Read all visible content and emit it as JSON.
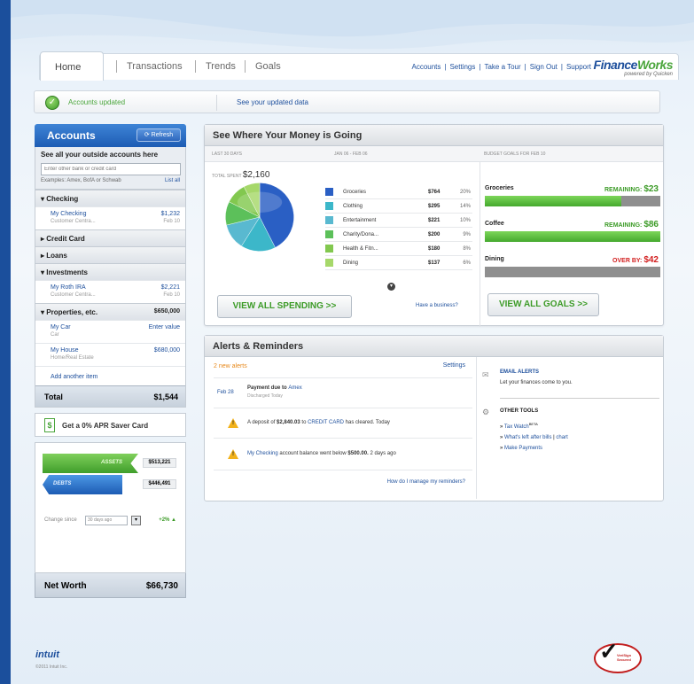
{
  "tabs": {
    "home": "Home",
    "transactions": "Transactions",
    "trends": "Trends",
    "goals": "Goals"
  },
  "top_links": {
    "accounts": "Accounts",
    "settings": "Settings",
    "tour": "Take a Tour",
    "signout": "Sign Out",
    "support": "Support",
    "sep": "|"
  },
  "logo": {
    "finance": "Finance",
    "works": "Works",
    "tagline": "powered by Quicken"
  },
  "status": {
    "updated": "Accounts updated",
    "see_data": "See your updated data"
  },
  "accounts": {
    "title": "Accounts",
    "refresh": "Refresh",
    "outside_title": "See all your outside accounts here",
    "search_placeholder": "Enter other bank or credit card",
    "examples": "Examples: Amex, BofA or Schwab",
    "list_all": "List all",
    "sections": {
      "checking": "Checking",
      "credit_card": "Credit Card",
      "loans": "Loans",
      "investments": "Investments",
      "properties": "Properties, etc.",
      "properties_amount": "$650,000"
    },
    "items": [
      {
        "name": "My Checking",
        "sub": "Customer Centra...",
        "value": "$1,232",
        "date": "Feb 10"
      },
      {
        "name": "My Roth IRA",
        "sub": "Customer Centra...",
        "value": "$2,221",
        "date": "Feb 10"
      },
      {
        "name": "My Car",
        "sub": "Car",
        "value": "Enter value",
        "date": ""
      },
      {
        "name": "My House",
        "sub": "Home/Real Estate",
        "value": "$680,000",
        "date": ""
      }
    ],
    "add_item": "Add another item",
    "total_label": "Total",
    "total_value": "$1,544"
  },
  "promo": {
    "text": "Get a 0% APR Saver Card",
    "icon": "dollar-icon"
  },
  "networth": {
    "assets_label": "ASSETS",
    "assets_value": "$513,221",
    "debts_label": "DEBTS",
    "debts_value": "$446,491",
    "change_label": "Change since",
    "change_period": "30 days ago",
    "change_value": "+2%",
    "label": "Net Worth",
    "value": "$66,730"
  },
  "spending": {
    "title": "See Where Your Money is Going",
    "col1": "LAST 30 DAYS",
    "col2": "JAN 06 - FEB 06",
    "col3": "BUDGET GOALS FOR FEB 10",
    "total_label": "TOTAL SPENT",
    "total_value": "$2,160",
    "categories": [
      {
        "name": "Groceries",
        "value": "$764",
        "pct": "20%",
        "color": "#2a5fc4"
      },
      {
        "name": "Clothing",
        "value": "$295",
        "pct": "14%",
        "color": "#3cb7c9"
      },
      {
        "name": "Entertainment",
        "value": "$221",
        "pct": "10%",
        "color": "#59b9d0"
      },
      {
        "name": "Charity/Dona...",
        "value": "$200",
        "pct": "9%",
        "color": "#5cc05a"
      },
      {
        "name": "Health & Fitn...",
        "value": "$180",
        "pct": "8%",
        "color": "#82c84f"
      },
      {
        "name": "Dining",
        "value": "$137",
        "pct": "6%",
        "color": "#a6d86a"
      }
    ],
    "view_all": "VIEW ALL SPENDING >>",
    "have_business": "Have a business?",
    "goals": [
      {
        "name": "Groceries",
        "status": "REMAINING:",
        "amount": "$23",
        "fill": 0.78,
        "color": "#3c9b27"
      },
      {
        "name": "Coffee",
        "status": "REMAINING:",
        "amount": "$86",
        "fill": 1.0,
        "color": "#3c9b27"
      },
      {
        "name": "Dining",
        "status": "OVER BY:",
        "amount": "$42",
        "fill": 0.0,
        "color": "#d21f1f"
      }
    ],
    "view_goals": "VIEW ALL GOALS >>"
  },
  "alerts": {
    "title": "Alerts & Reminders",
    "new_alerts": "2 new alerts",
    "settings": "Settings",
    "bill_date": "Feb 28",
    "bill_text": "Payment due to",
    "bill_payee": "Amex",
    "bill_sub": "Discharged Today",
    "deposit_pre": "A deposit of",
    "deposit_amount": "$2,840.03",
    "deposit_to": "to",
    "deposit_acct": "CREDIT CARD",
    "deposit_post": "has cleared. Today",
    "balance_acct": "My Checking",
    "balance_text": "account balance went below",
    "balance_amount": "$500.00.",
    "balance_post": "2 days ago",
    "manage": "How do I manage my reminders?",
    "email_title": "EMAIL ALERTS",
    "email_text": "Let your finances come to you.",
    "tools_title": "OTHER TOOLS",
    "tools": [
      "Tax Watch",
      "What's left after bills",
      "Make Payments"
    ],
    "tools_sup": "BETA",
    "tools_chart": "chart"
  },
  "footer": {
    "intuit": "intuit",
    "copyright": "©2011 Intuit Inc.",
    "seal_line1": "VeriSign",
    "seal_line2": "Secured"
  }
}
